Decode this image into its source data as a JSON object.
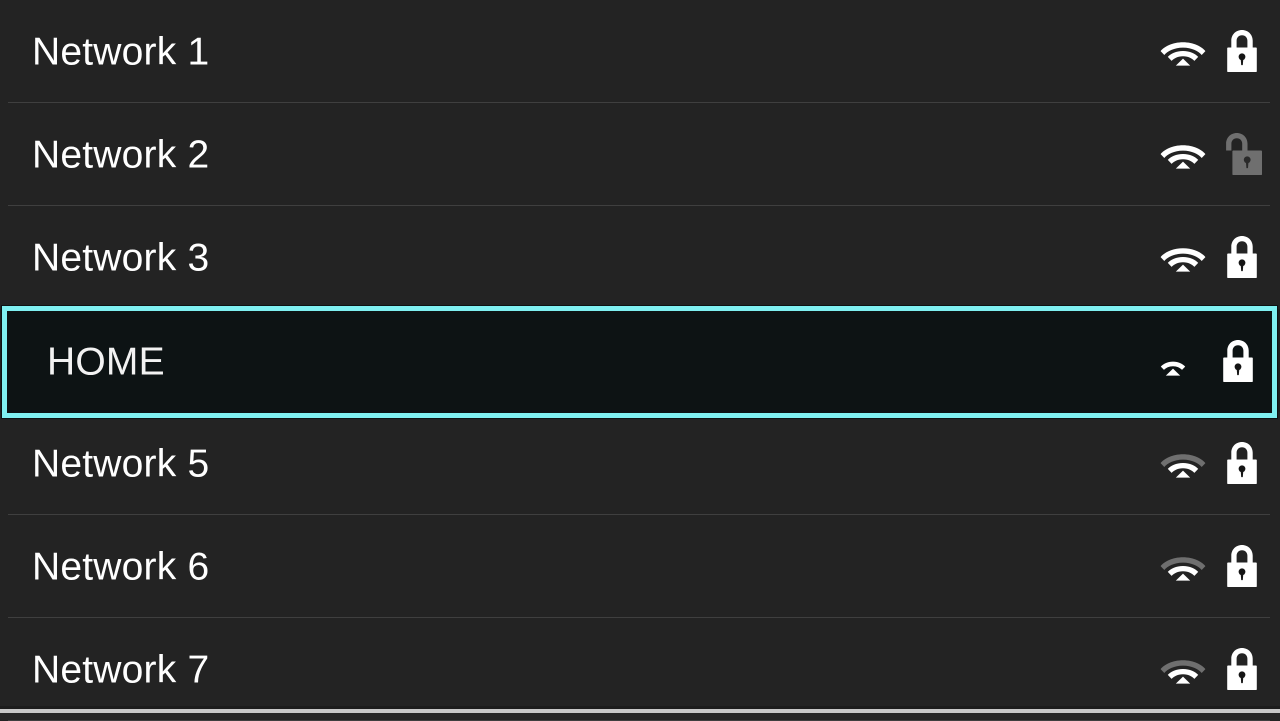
{
  "screen": {
    "title": "Wi-Fi network list",
    "background_color": "#1f1f1f",
    "row_background_color": "#232323",
    "selected_background_color": "#0d1314",
    "selected_border_color": "#7ff0f1",
    "separator_color": "#4a4a4a",
    "text_color": "#ffffff",
    "icon_color": "#ffffff",
    "icon_dim_color": "#6f6f6f"
  },
  "networks": [
    {
      "ssid": "Network 1",
      "selected": false,
      "signal_bars": 3,
      "signal_max": 3,
      "secured": true,
      "lock_state": "locked",
      "wifi_icon": "wifi-signal-icon",
      "lock_icon": "lock-closed-icon"
    },
    {
      "ssid": "Network 2",
      "selected": false,
      "signal_bars": 3,
      "signal_max": 3,
      "secured": false,
      "lock_state": "unlocked",
      "wifi_icon": "wifi-signal-icon",
      "lock_icon": "lock-open-icon"
    },
    {
      "ssid": "Network 3",
      "selected": false,
      "signal_bars": 3,
      "signal_max": 3,
      "secured": true,
      "lock_state": "locked",
      "wifi_icon": "wifi-signal-icon",
      "lock_icon": "lock-closed-icon"
    },
    {
      "ssid": "HOME",
      "selected": true,
      "signal_bars": 1,
      "signal_max": 3,
      "secured": true,
      "lock_state": "locked",
      "wifi_icon": "wifi-signal-icon",
      "lock_icon": "lock-closed-icon"
    },
    {
      "ssid": "Network 5",
      "selected": false,
      "signal_bars": 2,
      "signal_max": 3,
      "secured": true,
      "lock_state": "locked",
      "wifi_icon": "wifi-signal-icon",
      "lock_icon": "lock-closed-icon"
    },
    {
      "ssid": "Network 6",
      "selected": false,
      "signal_bars": 2,
      "signal_max": 3,
      "secured": true,
      "lock_state": "locked",
      "wifi_icon": "wifi-signal-icon",
      "lock_icon": "lock-closed-icon"
    },
    {
      "ssid": "Network 7",
      "selected": false,
      "signal_bars": 2,
      "signal_max": 3,
      "secured": true,
      "lock_state": "locked",
      "wifi_icon": "wifi-signal-icon",
      "lock_icon": "lock-closed-icon"
    }
  ],
  "scrollbar": {
    "name": "horizontal-scroll-indicator",
    "color": "#c8c8c8"
  }
}
